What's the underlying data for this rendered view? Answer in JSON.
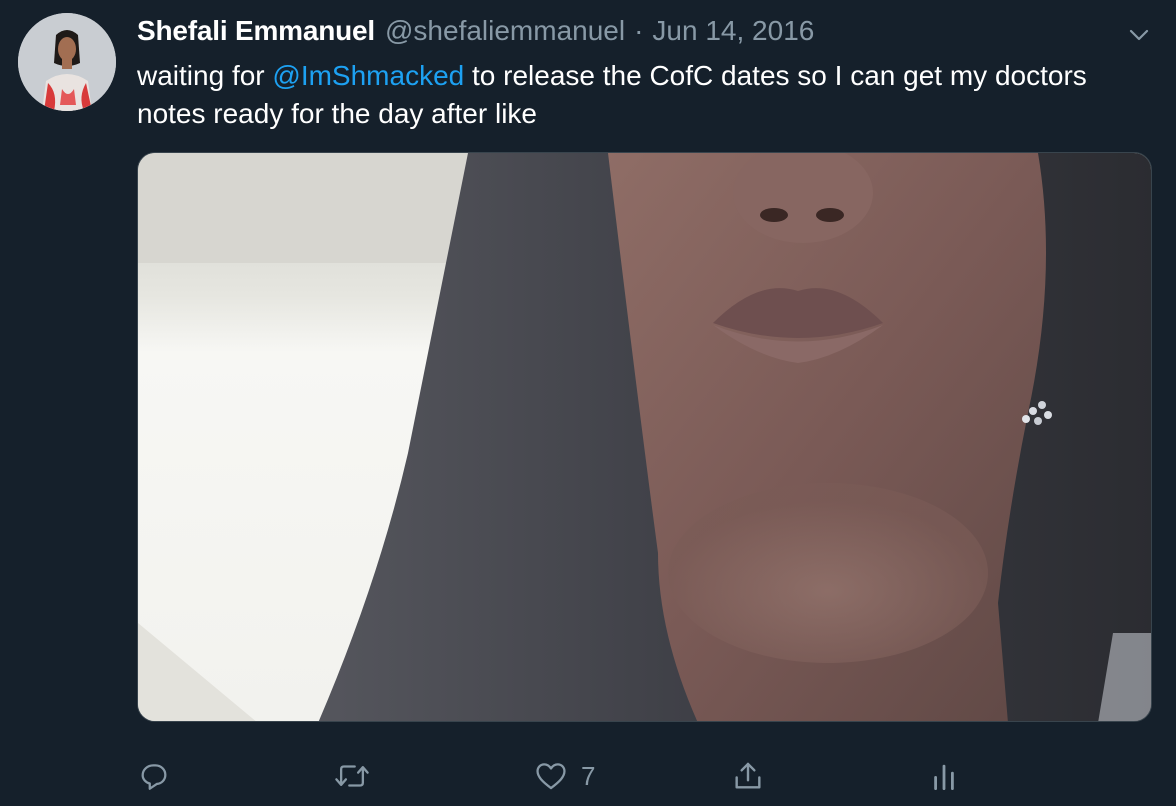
{
  "tweet": {
    "author_name": "Shefali Emmanuel",
    "author_handle": "@shefaliemmanuel",
    "separator": "·",
    "date": "Jun 14, 2016",
    "text_before": "waiting for ",
    "mention": "@ImShmacked",
    "text_after": " to release the CofC dates so I can get my doctors notes ready for the day after like"
  },
  "actions": {
    "reply": {
      "icon": "reply-icon"
    },
    "retweet": {
      "icon": "retweet-icon"
    },
    "like": {
      "icon": "heart-icon",
      "count": "7"
    },
    "share": {
      "icon": "share-icon"
    },
    "analytics": {
      "icon": "analytics-icon"
    }
  },
  "colors": {
    "background": "#15202b",
    "text_primary": "#ffffff",
    "text_secondary": "#8899a6",
    "link": "#1da1f2"
  }
}
